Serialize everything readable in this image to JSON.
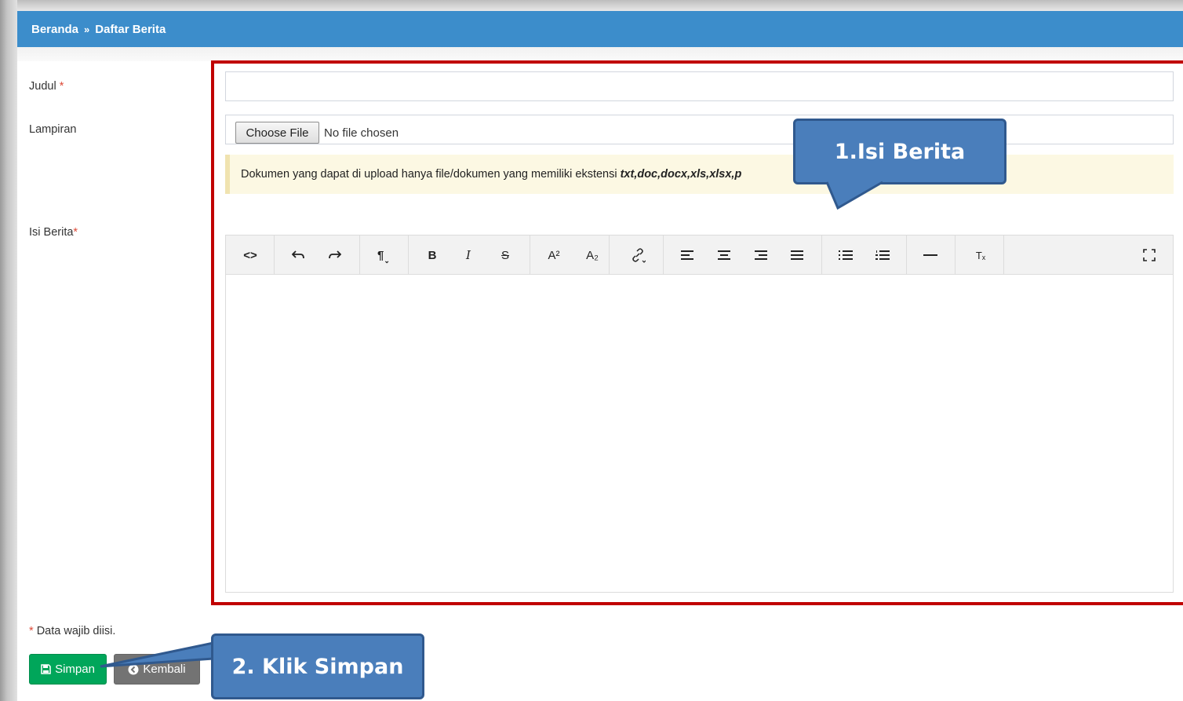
{
  "breadcrumb": {
    "home": "Beranda",
    "separator": "»",
    "current": "Daftar Berita"
  },
  "form": {
    "title_label": "Judul",
    "title_required_mark": "*",
    "title_value": "",
    "attachment_label": "Lampiran",
    "choose_file_label": "Choose File",
    "file_status": "No file chosen",
    "upload_note": "Dokumen yang dapat di upload hanya file/dokumen yang memiliki ekstensi",
    "upload_extensions": "txt,doc,docx,xls,xlsx,p",
    "content_label": "Isi Berita",
    "content_required_mark": "*",
    "content_value": ""
  },
  "editor_toolbar": {
    "code_view": "<>",
    "paragraph": "¶",
    "bold": "B",
    "italic": "I",
    "strikethrough": "S",
    "superscript": "A²",
    "subscript": "A₂",
    "clear_format": "Tₓ",
    "icons": [
      "code-view-icon",
      "undo-icon",
      "redo-icon",
      "paragraph-icon",
      "bold-icon",
      "italic-icon",
      "strikethrough-icon",
      "superscript-icon",
      "subscript-icon",
      "link-icon",
      "align-left-icon",
      "align-center-icon",
      "align-right-icon",
      "align-justify-icon",
      "unordered-list-icon",
      "ordered-list-icon",
      "horizontal-rule-icon",
      "clear-format-icon",
      "fullscreen-icon"
    ]
  },
  "footer": {
    "required_mark": "*",
    "required_note": "Data wajib diisi.",
    "save_label": "Simpan",
    "back_label": "Kembali"
  },
  "annotations": {
    "callout_1": "1.Isi Berita",
    "callout_2": "2. Klik Simpan"
  },
  "colors": {
    "header": "#3c8dcb",
    "save": "#00a65a",
    "back": "#737373",
    "highlight": "#c00000",
    "callout": "#4a7ebb",
    "required": "#dd4b39",
    "note_bg": "#fcf8e3"
  }
}
